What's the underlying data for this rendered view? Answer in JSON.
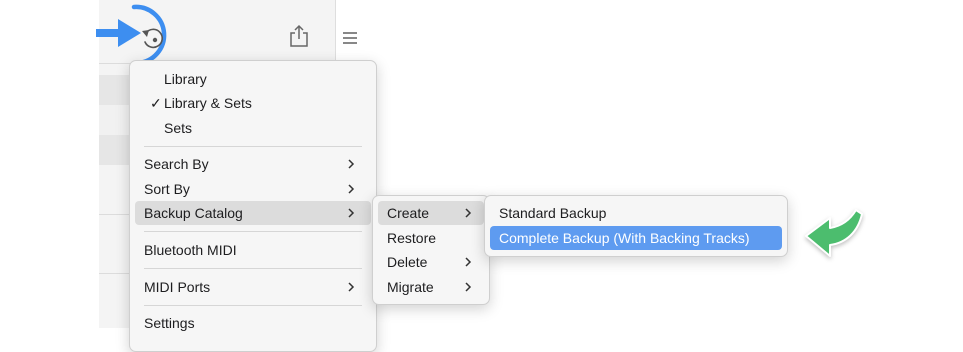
{
  "main_menu": {
    "library": "Library",
    "library_sets": "Library & Sets",
    "library_sets_check": "✓",
    "sets": "Sets",
    "search_by": "Search By",
    "sort_by": "Sort By",
    "backup_catalog": "Backup Catalog",
    "bluetooth_midi": "Bluetooth MIDI",
    "midi_ports": "MIDI Ports",
    "settings": "Settings"
  },
  "backup_submenu": {
    "create": "Create",
    "restore": "Restore",
    "delete": "Delete",
    "migrate": "Migrate"
  },
  "create_submenu": {
    "standard_backup": "Standard Backup",
    "complete_backup": "Complete Backup (With Backing Tracks)"
  },
  "toolbar": {
    "sync_icon": "sync-icon",
    "share_icon": "share-icon",
    "menu_icon": "hamburger-icon"
  },
  "colors": {
    "highlight_blue": "#5e9bf0",
    "annotation_blue": "#3d8ef0",
    "annotation_green": "#4cbd6e",
    "hover_gray": "#dcdcdc"
  }
}
